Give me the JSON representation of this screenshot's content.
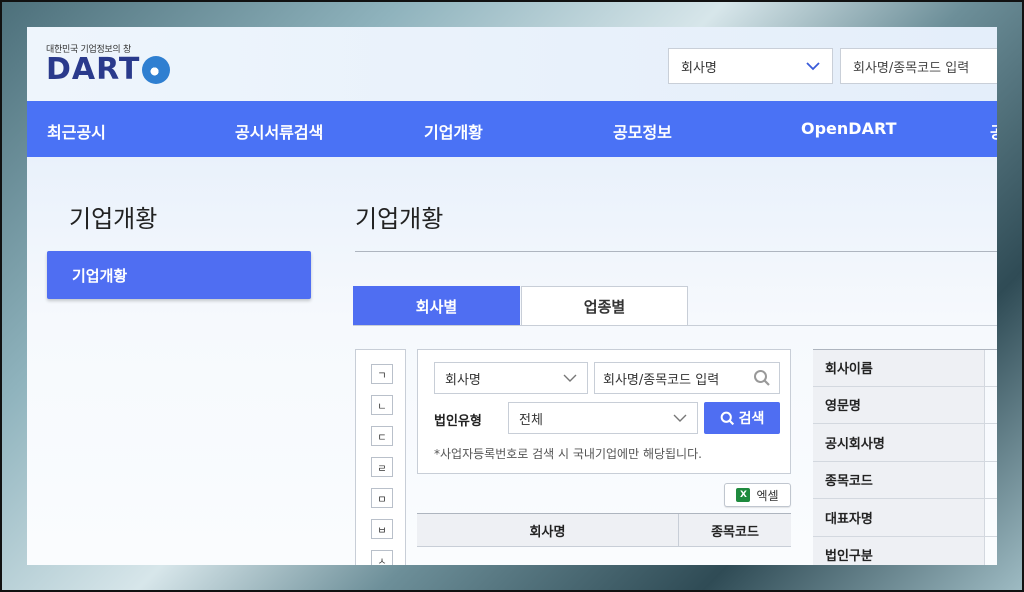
{
  "header": {
    "logo_tagline": "대한민국 기업정보의 창",
    "logo_text": "DART",
    "select_value": "회사명",
    "search_placeholder": "회사명/종목코드 입력"
  },
  "nav": {
    "items": [
      "최근공시",
      "공시서류검색",
      "기업개황",
      "공모정보",
      "OpenDART",
      "공"
    ]
  },
  "sidebar": {
    "title": "기업개황",
    "items": [
      {
        "label": "기업개황",
        "active": true
      }
    ]
  },
  "main": {
    "title": "기업개황",
    "tabs": [
      {
        "label": "회사별",
        "active": true
      },
      {
        "label": "업종별",
        "active": false
      }
    ],
    "letters": [
      "ㄱ",
      "ㄴ",
      "ㄷ",
      "ㄹ",
      "ㅁ",
      "ㅂ",
      "ㅅ"
    ],
    "search": {
      "select_value": "회사명",
      "input_placeholder": "회사명/종목코드 입력",
      "corp_type_label": "법인유형",
      "corp_type_value": "전체",
      "search_button": "검색",
      "note": "*사업자등록번호로 검색 시 국내기업에만 해당됩니다."
    },
    "excel_button": "엑셀",
    "result_columns": [
      "회사명",
      "종목코드"
    ],
    "info_labels": [
      "회사이름",
      "영문명",
      "공시회사명",
      "종목코드",
      "대표자명",
      "법인구분"
    ]
  },
  "colors": {
    "nav_bg": "#4a72f5",
    "accent": "#4f6ef2"
  }
}
